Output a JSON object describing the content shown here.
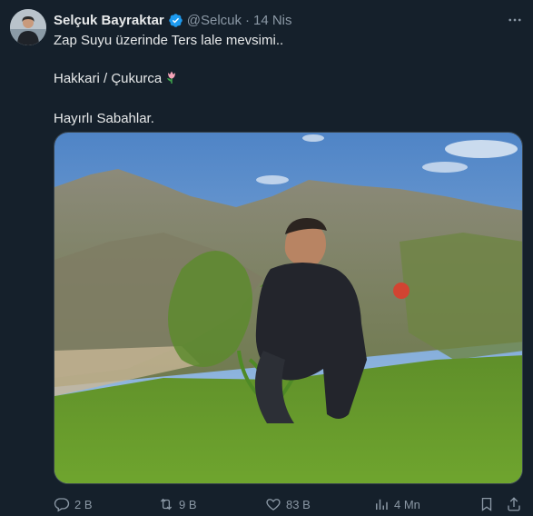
{
  "author": {
    "name": "Selçuk Bayraktar",
    "handle": "@Selcuk",
    "separator": "·",
    "date": "14 Nis",
    "verified": true,
    "verified_color": "#1d9bf0"
  },
  "post": {
    "line1": "Zap Suyu üzerinde Ters lale mevsimi..",
    "line2": "Hakkari / Çukurca",
    "line2_emoji": "tulip-emoji",
    "line3": "Hayırlı Sabahlar."
  },
  "media": {
    "description_icon": "photo"
  },
  "actions": {
    "replies": "2 B",
    "reposts": "9 B",
    "likes": "83 B",
    "views": "4 Mn"
  },
  "colors": {
    "background": "#15202b",
    "text": "#e7e9ea",
    "muted": "#8b98a5",
    "accent": "#1d9bf0"
  }
}
